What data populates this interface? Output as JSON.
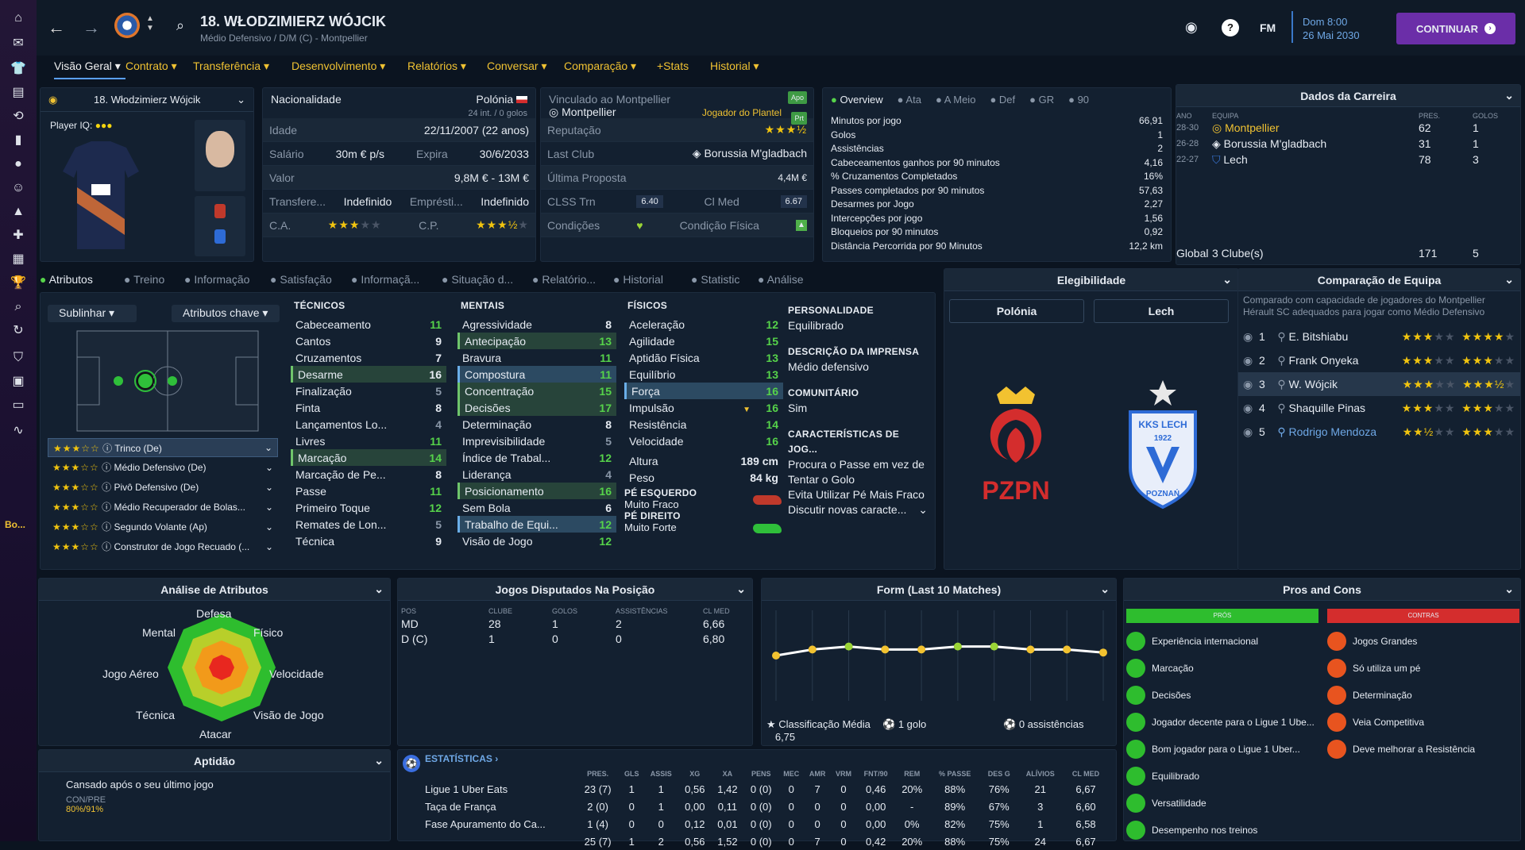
{
  "header": {
    "player_title": "18. WŁODZIMIERZ WÓJCIK",
    "subtitle": "Médio Defensivo / D/M (C) - Montpellier",
    "fm_label": "FM",
    "date_line1": "Dom 8:00",
    "date_line2": "26 Mai 2030",
    "continue_label": "CONTINUAR"
  },
  "nav_tabs": [
    "Visão Geral",
    "Contrato",
    "Transferência",
    "Desenvolvimento",
    "Relatórios",
    "Conversar",
    "Comparação",
    "+Stats",
    "Historial"
  ],
  "player_card": {
    "name": "18. Włodzimierz Wójcik",
    "iq_label": "Player IQ:"
  },
  "info": {
    "nationality_label": "Nacionalidade",
    "nationality": "Polónia",
    "caps": "24 int. / 0 golos",
    "age_label": "Idade",
    "age": "22/11/2007 (22 anos)",
    "salary_label": "Salário",
    "salary": "30m € p/s",
    "expires_label": "Expira",
    "expires": "30/6/2033",
    "value_label": "Valor",
    "value": "9,8M € - 13M €",
    "transfer_label": "Transfere...",
    "transfer_value": "Indefinido",
    "loan_label": "Emprésti...",
    "loan_value": "Indefinido",
    "ca_label": "C.A.",
    "cp_label": "C.P.",
    "bound_label": "Vinculado ao Montpellier",
    "bound_club": "Montpellier",
    "squad_role": "Jogador do Plantel",
    "apo_badge": "Apo",
    "prt_badge": "Prt",
    "reputation_label": "Reputação",
    "last_club_label": "Last Club",
    "last_club": "Borussia M'gladbach",
    "last_offer_label": "Última Proposta",
    "last_offer": "4,4M €",
    "clss_label": "CLSS Trn",
    "clss_value": "6.40",
    "clmed_label": "Cl Med",
    "clmed_value": "6.67",
    "conditions_label": "Condições",
    "fitness_label": "Condição Física"
  },
  "overview": {
    "tabs": [
      "Overview",
      "Ata",
      "A Meio",
      "Def",
      "GR",
      "90"
    ],
    "stats": [
      {
        "label": "Minutos por jogo",
        "value": "66,91"
      },
      {
        "label": "Golos",
        "value": "1"
      },
      {
        "label": "Assistências",
        "value": "2"
      },
      {
        "label": "Cabeceamentos ganhos por 90 minutos",
        "value": "4,16"
      },
      {
        "label": "% Cruzamentos Completados",
        "value": "16%"
      },
      {
        "label": "Passes completados por 90 minutos",
        "value": "57,63"
      },
      {
        "label": "Desarmes por Jogo",
        "value": "2,27"
      },
      {
        "label": "Intercepções por jogo",
        "value": "1,56"
      },
      {
        "label": "Bloqueios por 90 minutos",
        "value": "0,92"
      },
      {
        "label": "Distância Percorrida por 90 Minutos",
        "value": "12,2 km"
      }
    ]
  },
  "career": {
    "title": "Dados da Carreira",
    "headers": [
      "ANO",
      "EQUIPA",
      "PRES.",
      "GOLOS"
    ],
    "rows": [
      {
        "year": "28-30",
        "team": "Montpellier",
        "apps": "62",
        "goals": "1"
      },
      {
        "year": "26-28",
        "team": "Borussia M'gladbach",
        "apps": "31",
        "goals": "1"
      },
      {
        "year": "22-27",
        "team": "Lech",
        "apps": "78",
        "goals": "3"
      }
    ],
    "total_label": "Global",
    "total_clubs": "3 Clube(s)",
    "total_apps": "171",
    "total_goals": "5"
  },
  "sub_tabs": [
    "Atributos",
    "Treino",
    "Informação",
    "Satisfação",
    "Informaçã...",
    "Situação d...",
    "Relatório...",
    "Historial",
    "Statistic",
    "Análise"
  ],
  "attr_controls": {
    "highlight": "Sublinhar",
    "key_attrs": "Atributos chave"
  },
  "roles": [
    {
      "name": "Trinco (De)",
      "stars": "★★★☆☆"
    },
    {
      "name": "Médio Defensivo (De)",
      "stars": "★★★☆☆"
    },
    {
      "name": "Pivô Defensivo (De)",
      "stars": "★★★☆☆"
    },
    {
      "name": "Médio Recuperador de Bolas...",
      "stars": "★★★☆☆"
    },
    {
      "name": "Segundo Volante (Ap)",
      "stars": "★★★☆☆"
    },
    {
      "name": "Construtor de Jogo Recuado (...",
      "stars": "★★★☆☆"
    }
  ],
  "technical": {
    "title": "TÉCNICOS",
    "items": [
      {
        "name": "Cabeceamento",
        "value": "11"
      },
      {
        "name": "Cantos",
        "value": "9"
      },
      {
        "name": "Cruzamentos",
        "value": "7"
      },
      {
        "name": "Desarme",
        "value": "16"
      },
      {
        "name": "Finalização",
        "value": "5"
      },
      {
        "name": "Finta",
        "value": "8"
      },
      {
        "name": "Lançamentos Lo...",
        "value": "4"
      },
      {
        "name": "Livres",
        "value": "11"
      },
      {
        "name": "Marcação",
        "value": "14"
      },
      {
        "name": "Marcação de Pe...",
        "value": "8"
      },
      {
        "name": "Passe",
        "value": "11"
      },
      {
        "name": "Primeiro Toque",
        "value": "12"
      },
      {
        "name": "Remates de Lon...",
        "value": "5"
      },
      {
        "name": "Técnica",
        "value": "9"
      }
    ]
  },
  "mental": {
    "title": "MENTAIS",
    "items": [
      {
        "name": "Agressividade",
        "value": "8"
      },
      {
        "name": "Antecipação",
        "value": "13"
      },
      {
        "name": "Bravura",
        "value": "11"
      },
      {
        "name": "Compostura",
        "value": "11"
      },
      {
        "name": "Concentração",
        "value": "15"
      },
      {
        "name": "Decisões",
        "value": "17"
      },
      {
        "name": "Determinação",
        "value": "8"
      },
      {
        "name": "Imprevisibilidade",
        "value": "5"
      },
      {
        "name": "Índice de Trabal...",
        "value": "12"
      },
      {
        "name": "Liderança",
        "value": "4"
      },
      {
        "name": "Posicionamento",
        "value": "16"
      },
      {
        "name": "Sem Bola",
        "value": "6"
      },
      {
        "name": "Trabalho de Equi...",
        "value": "12"
      },
      {
        "name": "Visão de Jogo",
        "value": "12"
      }
    ]
  },
  "physical": {
    "title": "FÍSICOS",
    "items": [
      {
        "name": "Aceleração",
        "value": "12"
      },
      {
        "name": "Agilidade",
        "value": "15"
      },
      {
        "name": "Aptidão Física",
        "value": "13"
      },
      {
        "name": "Equilíbrio",
        "value": "13"
      },
      {
        "name": "Força",
        "value": "16"
      },
      {
        "name": "Impulsão",
        "value": "16"
      },
      {
        "name": "Resistência",
        "value": "14"
      },
      {
        "name": "Velocidade",
        "value": "16"
      }
    ],
    "height_label": "Altura",
    "height": "189 cm",
    "weight_label": "Peso",
    "weight": "84 kg",
    "left_foot_label": "PÉ ESQUERDO",
    "left_foot": "Muito Fraco",
    "right_foot_label": "PÉ DIREITO",
    "right_foot": "Muito Forte"
  },
  "personality": {
    "title": "PERSONALIDADE",
    "value": "Equilibrado",
    "press_title": "DESCRIÇÃO DA IMPRENSA",
    "press_value": "Médio defensivo",
    "comm_title": "COMUNITÁRIO",
    "comm_value": "Sim",
    "traits_title": "CARACTERÍSTICAS DE JOG...",
    "traits": [
      "Procura o Passe em vez de Tentar o Golo",
      "Evita Utilizar Pé Mais Fraco"
    ],
    "discuss": "Discutir novas caracte..."
  },
  "eligibility": {
    "title": "Elegibilidade",
    "btn1": "Polónia",
    "btn2": "Lech",
    "pzpn": "PZPN",
    "lech_top": "KKS LECH",
    "lech_year": "1922",
    "lech_bottom": "POZNAŃ"
  },
  "comparison": {
    "title": "Comparação de Equipa",
    "desc": "Comparado com capacidade de jogadores do Montpellier Hérault SC adequados para jogar como Médio Defensivo",
    "rows": [
      {
        "rank": "1",
        "name": "E. Bitshiabu"
      },
      {
        "rank": "2",
        "name": "Frank Onyeka"
      },
      {
        "rank": "3",
        "name": "W. Wójcik"
      },
      {
        "rank": "4",
        "name": "Shaquille Pinas"
      },
      {
        "rank": "5",
        "name": "Rodrigo Mendoza"
      }
    ]
  },
  "analysis": {
    "title": "Análise de Atributos",
    "labels": {
      "top": "Defesa",
      "tr": "Físico",
      "r": "Velocidade",
      "br": "Visão de Jogo",
      "bottom": "Atacar",
      "bl": "Técnica",
      "l": "Jogo Aéreo",
      "tl": "Mental"
    }
  },
  "positions": {
    "title": "Jogos Disputados Na Posição",
    "headers": [
      "POS",
      "CLUBE",
      "GOLOS",
      "ASSISTÊNCIAS",
      "CL MED"
    ],
    "rows": [
      {
        "pos": "MD",
        "club": "28",
        "goals": "1",
        "assists": "2",
        "rating": "6,66"
      },
      {
        "pos": "D (C)",
        "club": "1",
        "goals": "0",
        "assists": "0",
        "rating": "6,80"
      }
    ]
  },
  "form": {
    "title": "Form (Last 10 Matches)",
    "avg_label": "Classificação Média",
    "avg": "6,75",
    "goals": "1 golo",
    "assists": "0 assistências"
  },
  "chart_data": {
    "type": "line",
    "title": "Form (Last 10 Matches)",
    "x": [
      1,
      2,
      3,
      4,
      5,
      6,
      7,
      8,
      9,
      10
    ],
    "values": [
      6.5,
      6.7,
      6.8,
      6.7,
      6.7,
      6.8,
      6.8,
      6.7,
      6.7,
      6.6
    ],
    "ylim": [
      5.0,
      8.0
    ]
  },
  "pros_cons": {
    "title": "Pros and Cons",
    "pros_label": "PRÓS",
    "cons_label": "CONTRAS",
    "pros": [
      "Experiência internacional",
      "Marcação",
      "Decisões",
      "Jogador decente para o Ligue 1 Ube...",
      "Bom jogador para o Ligue 1 Uber...",
      "Equilibrado",
      "Versatilidade",
      "Desempenho nos treinos"
    ],
    "cons": [
      "Jogos Grandes",
      "Só utiliza um pé",
      "Determinação",
      "Veia Competitiva",
      "Deve melhorar a Resistência"
    ]
  },
  "aptitude": {
    "title": "Aptidão",
    "text": "Cansado após o seu último jogo",
    "con_label": "CON/PRE",
    "con_value": "80%/91%"
  },
  "stats_table": {
    "title": "ESTATÍSTICAS",
    "headers": [
      "PRES.",
      "GLS",
      "ASSIS",
      "XG",
      "XA",
      "PENS",
      "MEC",
      "AMR",
      "VRM",
      "FNT/90",
      "REM",
      "% PASSE",
      "DES G",
      "ALÍVIOS",
      "CL MED"
    ],
    "rows": [
      {
        "comp": "Ligue 1 Uber Eats",
        "cells": [
          "23 (7)",
          "1",
          "1",
          "0,56",
          "1,42",
          "0 (0)",
          "0",
          "7",
          "0",
          "0,46",
          "20%",
          "88%",
          "76%",
          "21",
          "6,67"
        ]
      },
      {
        "comp": "Taça de França",
        "cells": [
          "2 (0)",
          "0",
          "1",
          "0,00",
          "0,11",
          "0 (0)",
          "0",
          "0",
          "0",
          "0,00",
          "-",
          "89%",
          "67%",
          "3",
          "6,60"
        ]
      },
      {
        "comp": "Fase Apuramento do Ca...",
        "cells": [
          "1 (4)",
          "0",
          "0",
          "0,12",
          "0,01",
          "0 (0)",
          "0",
          "0",
          "0",
          "0,00",
          "0%",
          "82%",
          "75%",
          "1",
          "6,58"
        ]
      },
      {
        "comp": "",
        "cells": [
          "25 (7)",
          "1",
          "2",
          "0,56",
          "1,52",
          "0 (0)",
          "0",
          "7",
          "0",
          "0,42",
          "20%",
          "88%",
          "75%",
          "24",
          "6,67"
        ]
      }
    ]
  },
  "sidebar_tail": "Bo..."
}
